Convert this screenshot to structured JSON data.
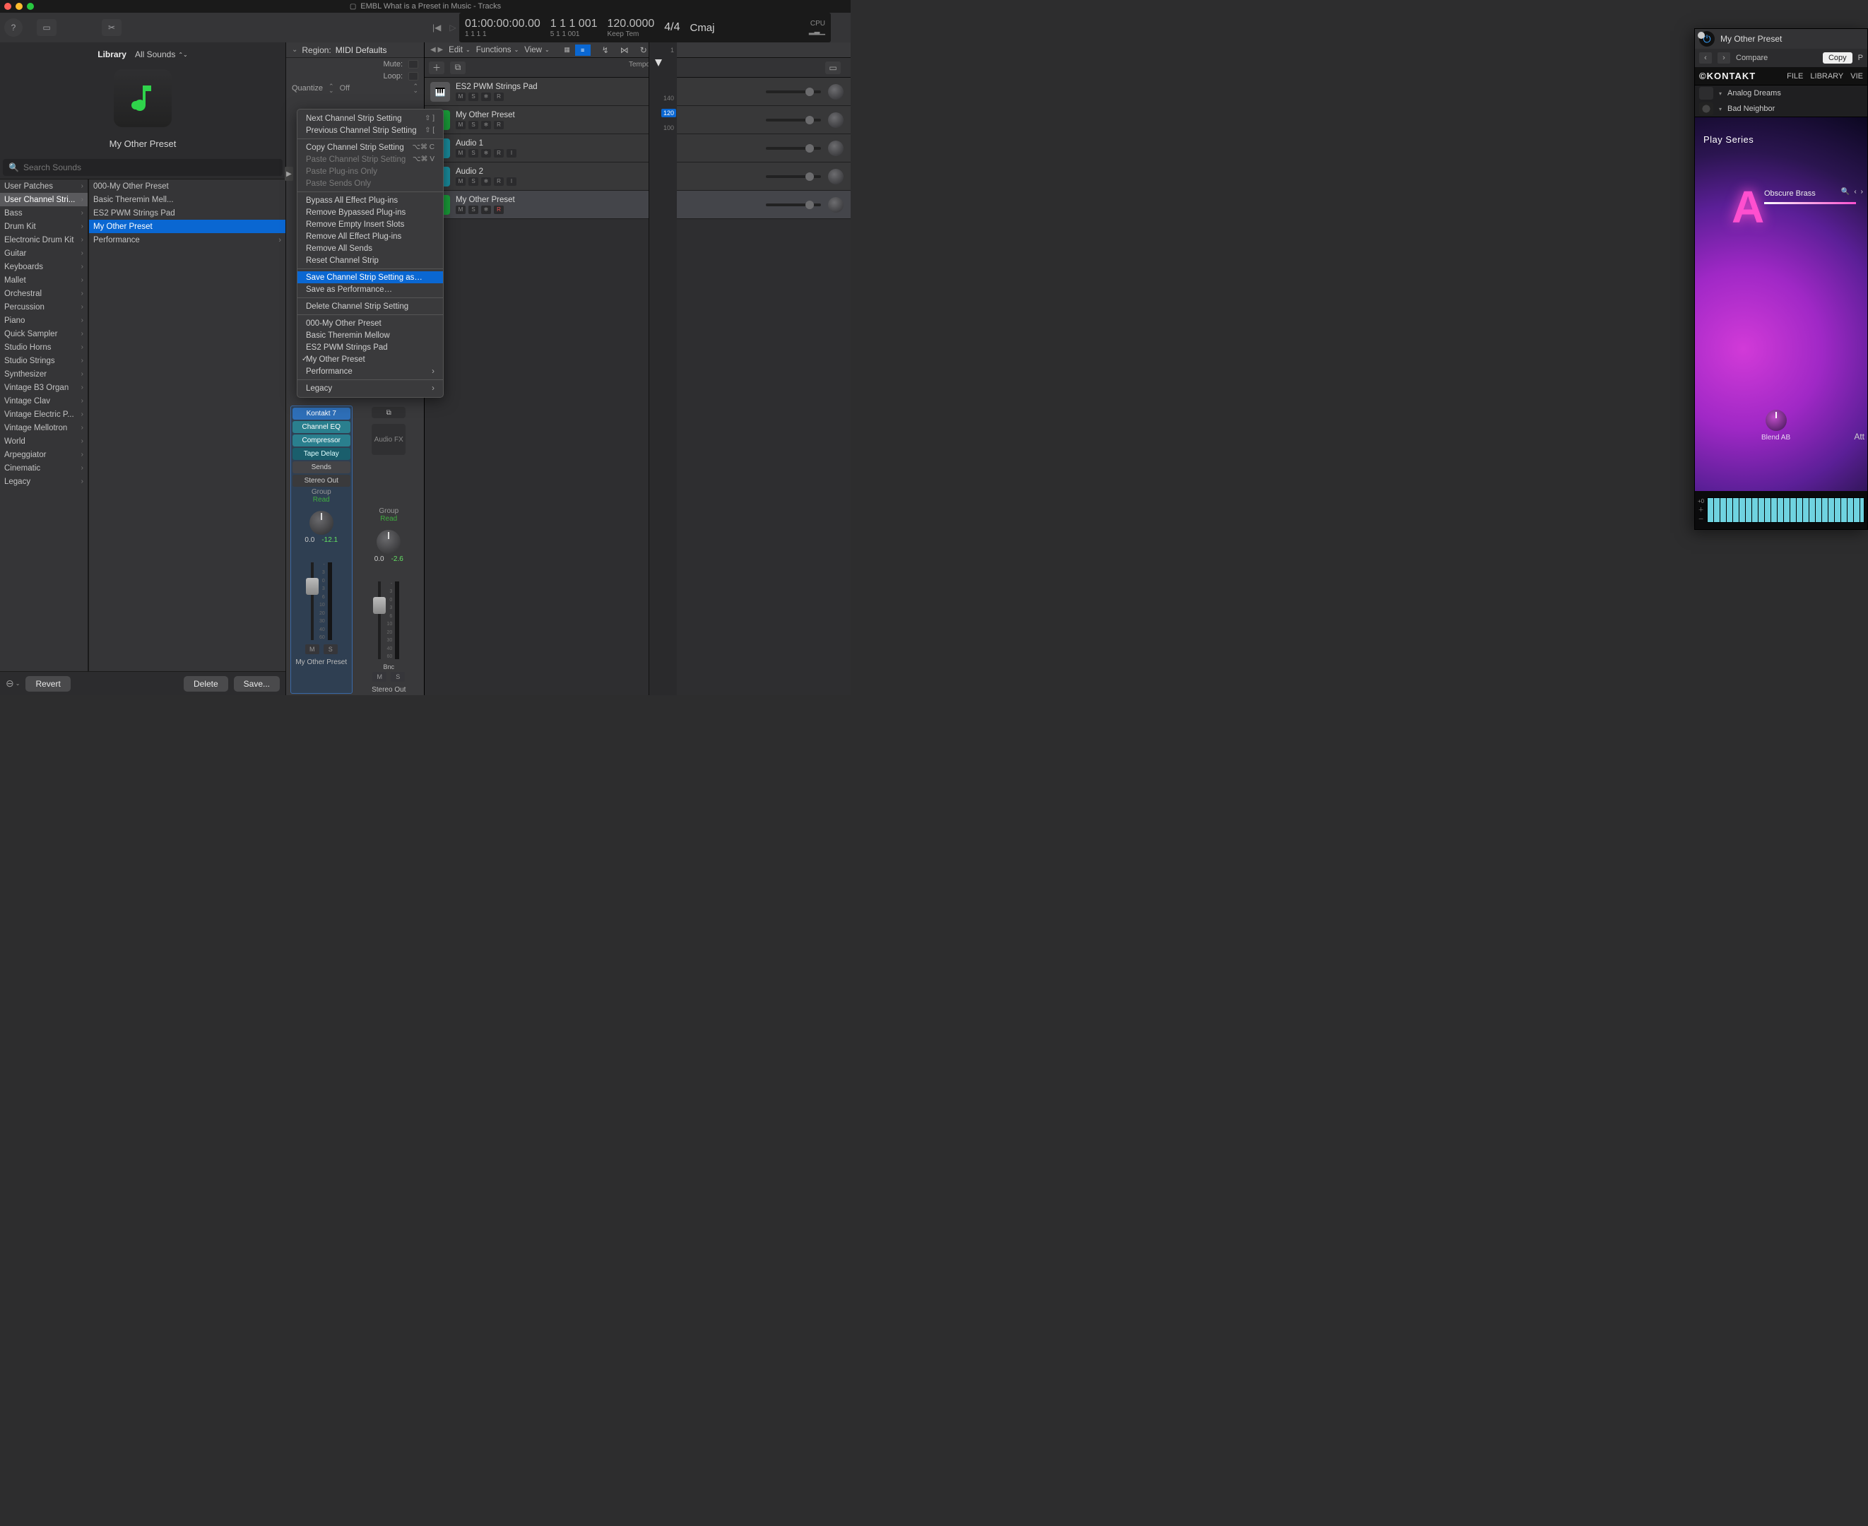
{
  "window": {
    "doc_icon": "doc",
    "title": "EMBL What is a Preset in Music - Tracks"
  },
  "lcd": {
    "timecode": "01:00:00:00.00",
    "timecode_sub": "1   1   1    1",
    "bars": "1   1   1  001",
    "bars_sub": "5   1   1  001",
    "tempo": "120.0000",
    "tempo_sub": "Keep Tem",
    "timesig": "4/4",
    "key": "Cmaj",
    "cpu_label": "CPU"
  },
  "library": {
    "tab_library": "Library",
    "tab_sounds": "All Sounds",
    "preset_title": "My Other Preset",
    "search_placeholder": "Search Sounds",
    "categories": [
      "User Patches",
      "User Channel Stri...",
      "Bass",
      "Drum Kit",
      "Electronic Drum Kit",
      "Guitar",
      "Keyboards",
      "Mallet",
      "Orchestral",
      "Percussion",
      "Piano",
      "Quick Sampler",
      "Studio Horns",
      "Studio Strings",
      "Synthesizer",
      "Vintage B3 Organ",
      "Vintage Clav",
      "Vintage Electric P...",
      "Vintage Mellotron",
      "World",
      "Arpeggiator",
      "Cinematic",
      "Legacy"
    ],
    "cat_selected_index": 1,
    "patches": [
      {
        "label": "000-My Other Preset",
        "arrow": false
      },
      {
        "label": "Basic Theremin Mell...",
        "arrow": false
      },
      {
        "label": "ES2 PWM Strings Pad",
        "arrow": false
      },
      {
        "label": "My Other Preset",
        "arrow": false
      },
      {
        "label": "Performance",
        "arrow": true
      }
    ],
    "patch_selected_index": 3,
    "revert": "Revert",
    "delete": "Delete",
    "save": "Save..."
  },
  "inspector": {
    "region_label": "Region:",
    "region_name": "MIDI Defaults",
    "mute": "Mute:",
    "loop": "Loop:",
    "quantize": "Quantize",
    "quantize_val": "Off",
    "strip_a": {
      "instrument": "Kontakt 7",
      "fx": [
        "Channel EQ",
        "Compressor",
        "Tape Delay"
      ],
      "sends": "Sends",
      "out": "Stereo Out",
      "group": "Group",
      "read": "Read",
      "pan": "0.0",
      "gain": "-12.1",
      "scale": [
        "-",
        "3",
        "0",
        "3",
        "6",
        "10",
        "20",
        "30",
        "40",
        "60"
      ],
      "m": "M",
      "s": "S",
      "name": "My Other Preset"
    },
    "strip_b": {
      "link_icon": "stereo",
      "fxbox": "Audio FX",
      "group": "Group",
      "read": "Read",
      "pan": "0.0",
      "gain": "-2.6",
      "bnc": "Bnc",
      "scale": [
        "-",
        "3",
        "0",
        "3",
        "6",
        "10",
        "20",
        "30",
        "40",
        "60"
      ],
      "m": "M",
      "s": "S",
      "name": "Stereo Out"
    }
  },
  "tracks_toolbar": {
    "edit": "Edit",
    "functions": "Functions",
    "view": "View"
  },
  "tracks_header_label": "Tempo",
  "ruler": {
    "cur": "1",
    "m120": "120",
    "m140": "140",
    "m100": "100"
  },
  "tracks": [
    {
      "icon": "synth",
      "name": "ES2 PWM Strings Pad",
      "btns": [
        "M",
        "S",
        "❄",
        "R"
      ],
      "rec": false
    },
    {
      "icon": "green",
      "name": "My Other Preset",
      "btns": [
        "M",
        "S",
        "❄",
        "R"
      ],
      "rec": false
    },
    {
      "icon": "audio",
      "name": "Audio 1",
      "btns": [
        "M",
        "S",
        "❄",
        "R",
        "I"
      ],
      "rec": false
    },
    {
      "icon": "audio",
      "name": "Audio 2",
      "btns": [
        "M",
        "S",
        "❄",
        "R",
        "I"
      ],
      "rec": false
    },
    {
      "icon": "green",
      "name": "My Other Preset",
      "btns": [
        "M",
        "S",
        "❄",
        "R"
      ],
      "rec": true
    }
  ],
  "track_selected_index": 4,
  "ctx_menu": {
    "groups": [
      [
        {
          "label": "Next Channel Strip Setting",
          "shortcut": "⇧ ]"
        },
        {
          "label": "Previous Channel Strip Setting",
          "shortcut": "⇧ ["
        }
      ],
      [
        {
          "label": "Copy Channel Strip Setting",
          "shortcut": "⌥⌘ C"
        },
        {
          "label": "Paste Channel Strip Setting",
          "shortcut": "⌥⌘ V",
          "disabled": true
        },
        {
          "label": "Paste Plug-ins Only",
          "disabled": true
        },
        {
          "label": "Paste Sends Only",
          "disabled": true
        }
      ],
      [
        {
          "label": "Bypass All Effect Plug-ins"
        },
        {
          "label": "Remove Bypassed Plug-ins"
        },
        {
          "label": "Remove Empty Insert Slots"
        },
        {
          "label": "Remove All Effect Plug-ins"
        },
        {
          "label": "Remove All Sends"
        },
        {
          "label": "Reset Channel Strip"
        }
      ],
      [
        {
          "label": "Save Channel Strip Setting as…",
          "selected": true
        },
        {
          "label": "Save as Performance…"
        }
      ],
      [
        {
          "label": "Delete Channel Strip Setting"
        }
      ],
      [
        {
          "label": "000-My Other Preset"
        },
        {
          "label": "Basic Theremin Mellow"
        },
        {
          "label": "ES2 PWM Strings Pad"
        },
        {
          "label": "My Other Preset",
          "checked": true
        },
        {
          "label": "Performance",
          "submenu": true
        }
      ],
      [
        {
          "label": "Legacy",
          "submenu": true
        }
      ]
    ]
  },
  "plugin": {
    "title": "My Other Preset",
    "compare": "Compare",
    "copy": "Copy",
    "paste_stub": "P",
    "kontakt": "©KONTAKT",
    "file": "FILE",
    "library": "LIBRARY",
    "view": "VIE",
    "patches": [
      {
        "name": "Analog Dreams"
      },
      {
        "name": "Bad Neighbor"
      }
    ],
    "play": "Play Series",
    "ob": "Obscure Brass",
    "knob1": "Blend AB",
    "knob2": "Att",
    "oct": "+0"
  }
}
